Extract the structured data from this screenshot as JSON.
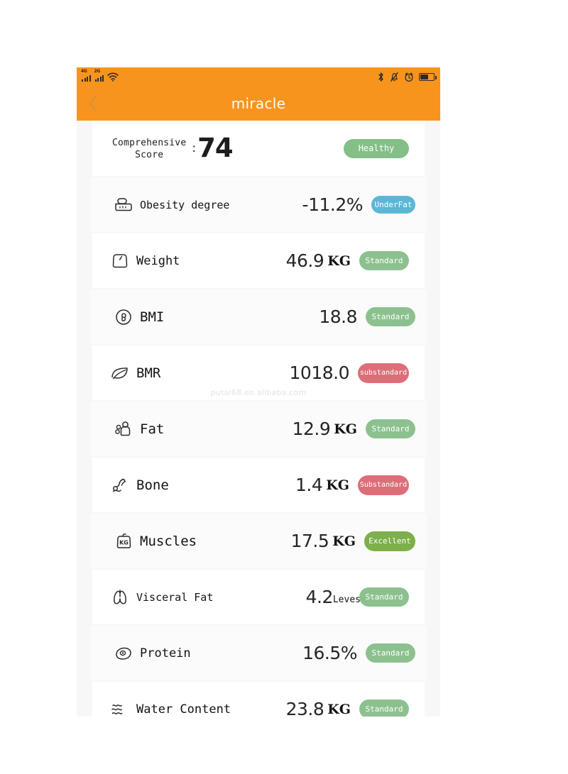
{
  "statusbar": {
    "signal_1": "4G",
    "signal_2": "2G",
    "wifi_icon": "wifi-icon",
    "bluetooth_icon": "bluetooth-icon",
    "mute_icon": "bell-muted-icon",
    "alarm_icon": "alarm-clock-icon",
    "battery_icon": "battery-icon",
    "battery_level": 62
  },
  "navbar": {
    "back_icon": "chevron-left-icon",
    "title": "miracle",
    "background": "#F7941E"
  },
  "score": {
    "label_line1": "Comprehensive",
    "label_line2": "Score",
    "colon": ":",
    "value": "74",
    "badge": "Healthy",
    "badge_color": "#83bf86"
  },
  "watermark": "putai68.en.alibaba.com",
  "rows": [
    {
      "icon": "obesity-scale-icon",
      "label": "Obesity degree",
      "value": "-11.2%",
      "unit": "",
      "badge": "UnderFat",
      "badge_style": "underfat",
      "badge_color": "#5cb7d6"
    },
    {
      "icon": "weight-scale-icon",
      "label": "Weight",
      "value": "46.9",
      "unit": "KG",
      "badge": "Standard",
      "badge_style": "std",
      "badge_color": "#8cc18f"
    },
    {
      "icon": "bmi-icon",
      "label": "BMI",
      "value": "18.8",
      "unit": "",
      "badge": "Standard",
      "badge_style": "std",
      "badge_color": "#8cc18f"
    },
    {
      "icon": "bmr-leaf-icon",
      "label": "BMR",
      "value": "1018.0",
      "unit": "",
      "badge": "substandard",
      "badge_style": "sub",
      "badge_color": "#dd6e78"
    },
    {
      "icon": "fat-icon",
      "label": "Fat",
      "value": "12.9",
      "unit": "KG",
      "badge": "Standard",
      "badge_style": "std",
      "badge_color": "#8cc18f"
    },
    {
      "icon": "bone-icon",
      "label": "Bone",
      "value": "1.4",
      "unit": "KG",
      "badge": "Substandard",
      "badge_style": "sub",
      "badge_color": "#dd6e78"
    },
    {
      "icon": "muscle-kg-icon",
      "label": "Muscles",
      "value": "17.5",
      "unit": "KG",
      "badge": "Excellent",
      "badge_style": "exc",
      "badge_color": "#7daf4b"
    },
    {
      "icon": "visceral-fat-lungs-icon",
      "label": "Visceral Fat",
      "value": "4.2",
      "unit": "Leves",
      "badge": "Standard",
      "badge_style": "std",
      "badge_color": "#8cc18f"
    },
    {
      "icon": "protein-icon",
      "label": "Protein",
      "value": "16.5%",
      "unit": "",
      "badge": "Standard",
      "badge_style": "std",
      "badge_color": "#8cc18f"
    },
    {
      "icon": "water-waves-icon",
      "label": "Water Content",
      "value": "23.8",
      "unit": "KG",
      "badge": "Standard",
      "badge_style": "std",
      "badge_color": "#8cc18f"
    }
  ]
}
